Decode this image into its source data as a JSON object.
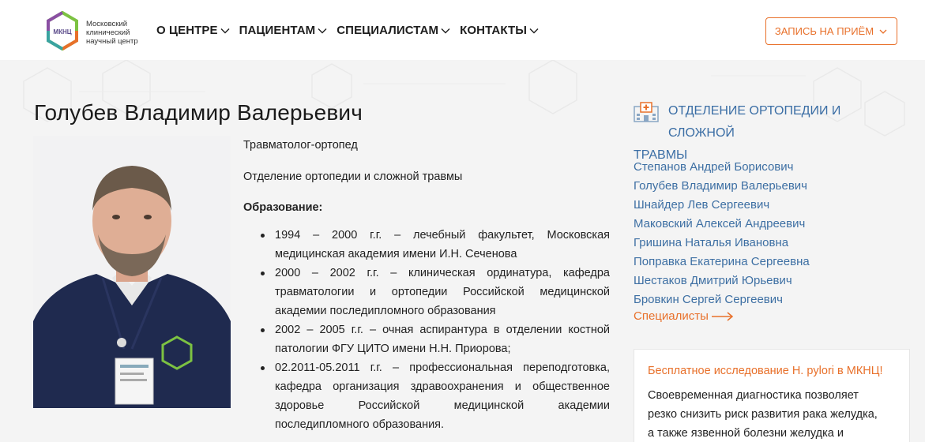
{
  "header": {
    "logo": {
      "mark_text": "МКНЦ",
      "line1": "Московский",
      "line2": "клинический",
      "line3": "научный центр"
    },
    "nav": [
      {
        "label": "О ЦЕНТРЕ"
      },
      {
        "label": "ПАЦИЕНТАМ"
      },
      {
        "label": "СПЕЦИАЛИСТАМ"
      },
      {
        "label": "КОНТАКТЫ"
      }
    ],
    "appointment_button": "ЗАПИСЬ НА ПРИЁМ"
  },
  "doctor": {
    "name": "Голубев Владимир Валерьевич",
    "photo_icon": "doctor-portrait",
    "role": "Травматолог-ортопед",
    "department": "Отделение ортопедии и сложной травмы",
    "education_title": "Образование:",
    "education": [
      "1994 – 2000 г.г. – лечебный факультет, Московская медицинская академия имени И.Н. Сеченова",
      "2000 – 2002 г.г. – клиническая ординатура, кафедра травматологии и ортопедии Российской медицинской академии последипломного образования",
      "2002 – 2005 г.г. – очная аспирантура в отделении костной патологии ФГУ ЦИТО имени Н.Н. Приорова;",
      "02.2011-05.2011 г.г. – профессиональная переподготовка, кафедра организация здравоохранения и общественное здоровье Российской медицинской академии последипломного образования."
    ]
  },
  "sidebar": {
    "department_title_line1": "ОТДЕЛЕНИЕ ОРТОПЕДИИ И СЛОЖНОЙ",
    "department_title_line2": "ТРАВМЫ",
    "doctors": [
      "Степанов Андрей Борисович",
      "Голубев Владимир Валерьевич",
      "Шнайдер Лев Сергеевич",
      "Маковский Алексей Андреевич",
      "Гришина Наталья Ивановна",
      "Поправка Екатерина Сергеевна",
      "Шестаков Дмитрий Юрьевич",
      "Бровкин Сергей Сергеевич"
    ],
    "specialists_link": "Специалисты",
    "promo": {
      "title": "Бесплатное исследование H. pylori в МКНЦ!",
      "text_line1": "Своевременная диагностика позволяет",
      "text_line2": "резко снизить риск развития рака желудка,",
      "text_line3": "а также язвенной болезни желудка и"
    }
  },
  "colors": {
    "accent_orange": "#e8702a",
    "link_blue": "#3d6fa3",
    "background": "#f4f4f4"
  }
}
